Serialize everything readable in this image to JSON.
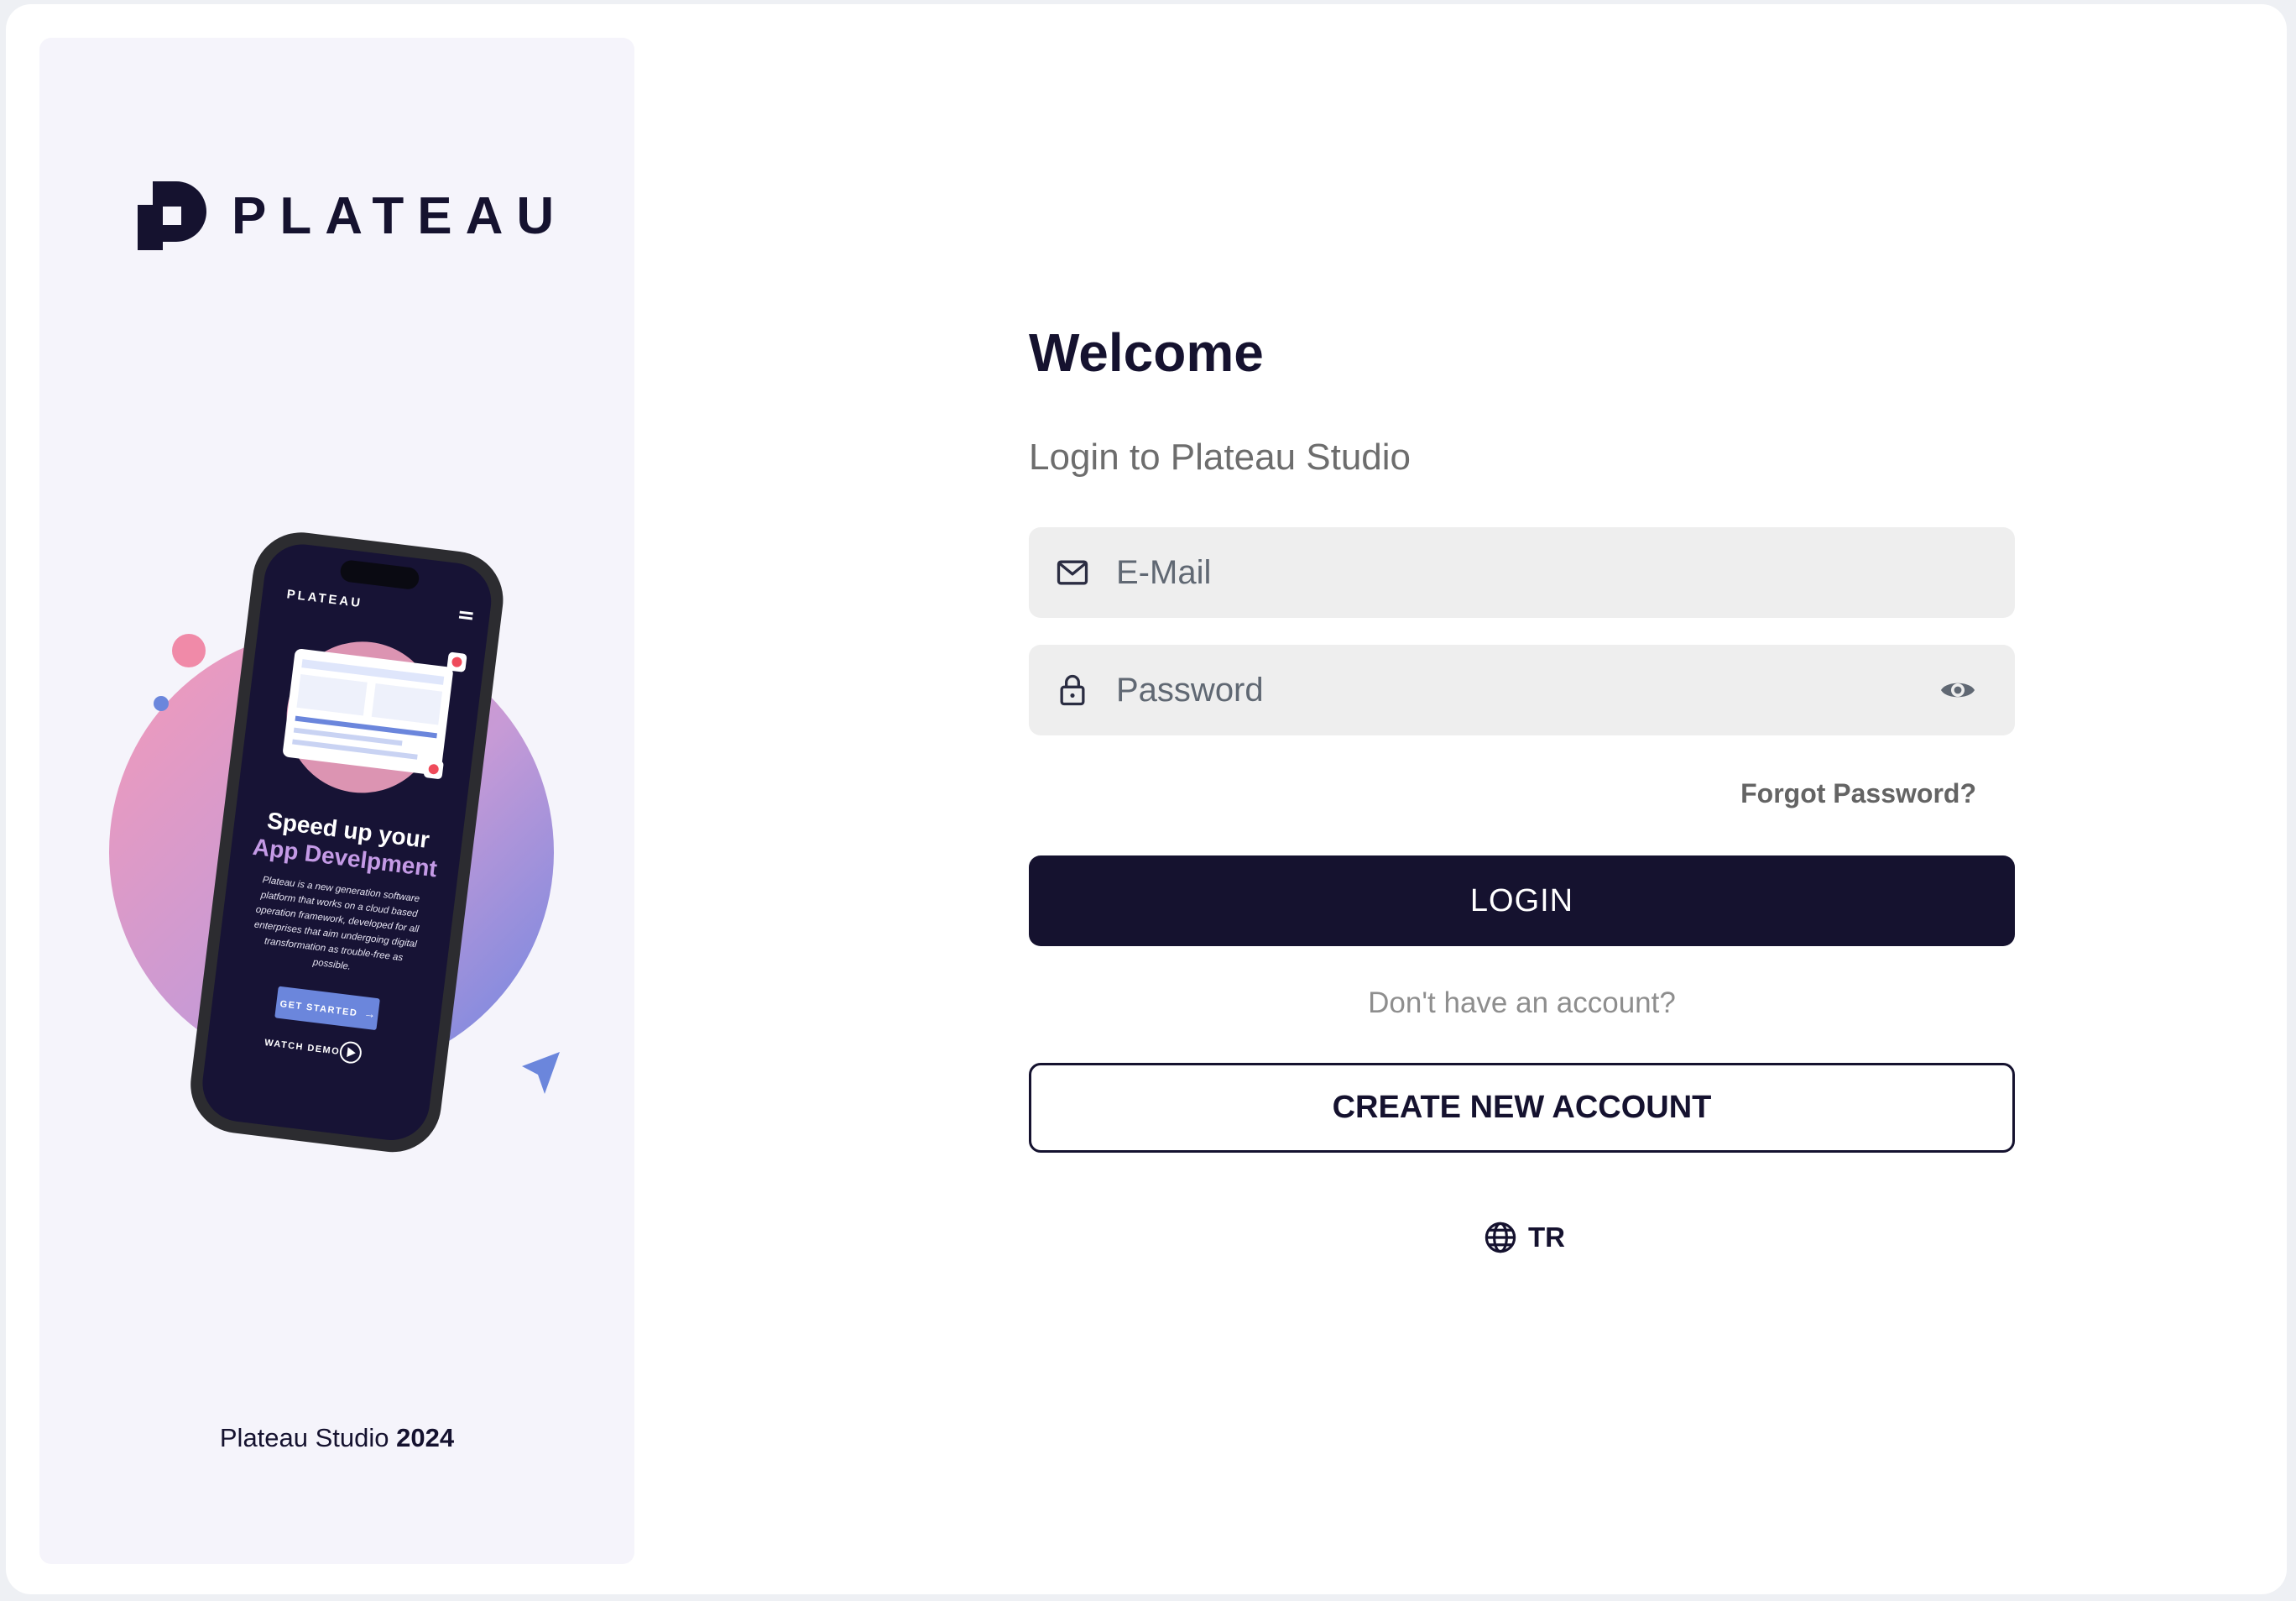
{
  "brand": {
    "logo_text": "PLATEAU",
    "footer_name": "Plateau Studio",
    "footer_year": "2024",
    "colors": {
      "primary": "#15122f",
      "panel": "#f5f4fb",
      "field": "#eeeeee"
    }
  },
  "promo": {
    "phone_logo": "PLATEAU",
    "headline_1": "Speed up your",
    "headline_2": "App Develpment",
    "body": [
      "Plateau is a new generation software",
      "platform that works on a cloud based",
      "operation framework, developed for all",
      "enterprises that aim undergoing digital",
      "transformation as trouble-free as",
      "possible."
    ],
    "cta": "GET STARTED",
    "demo": "WATCH DEMO"
  },
  "form": {
    "title": "Welcome",
    "subtitle": "Login to Plateau Studio",
    "email_placeholder": "E-Mail",
    "password_placeholder": "Password",
    "forgot_label": "Forgot Password?",
    "login_label": "LOGIN",
    "no_account": "Don't have an account?",
    "create_label": "CREATE NEW ACCOUNT",
    "language": "TR"
  },
  "icons": [
    "logo-icon",
    "mail-icon",
    "lock-icon",
    "eye-icon",
    "globe-icon"
  ]
}
